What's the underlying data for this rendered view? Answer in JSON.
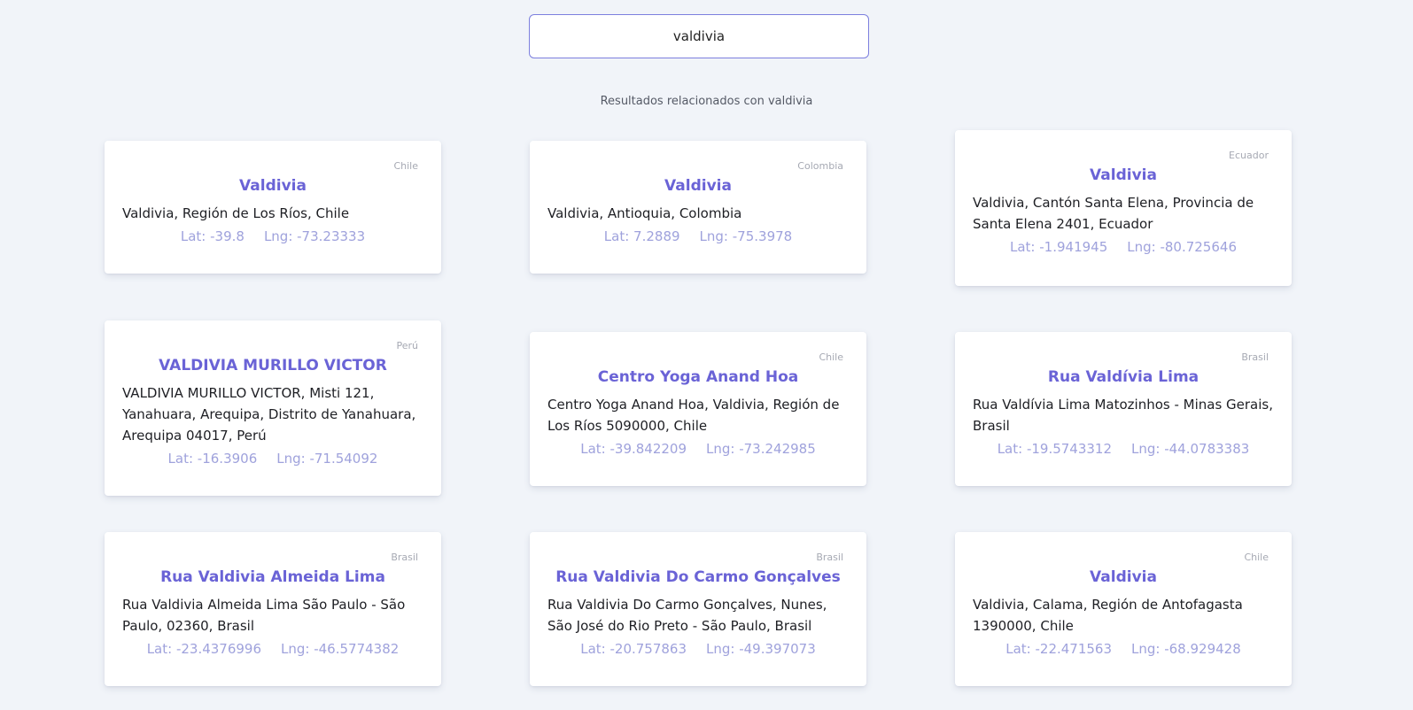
{
  "search": {
    "value": "valdivia"
  },
  "results_heading": "Resultados relacionados con valdivia",
  "results": [
    {
      "country": "Chile",
      "title": "Valdivia",
      "address": "Valdivia, Región de Los Ríos, Chile",
      "lat": "Lat: -39.8",
      "lng": "Lng: -73.23333"
    },
    {
      "country": "Colombia",
      "title": "Valdivia",
      "address": "Valdivia, Antioquia, Colombia",
      "lat": "Lat: 7.2889",
      "lng": "Lng: -75.3978"
    },
    {
      "country": "Ecuador",
      "title": "Valdivia",
      "address": "Valdivia, Cantón Santa Elena, Provincia de Santa Elena 2401, Ecuador",
      "lat": "Lat: -1.941945",
      "lng": "Lng: -80.725646"
    },
    {
      "country": "Perú",
      "title": "VALDIVIA MURILLO VICTOR",
      "address": "VALDIVIA MURILLO VICTOR, Misti 121, Yanahuara, Arequipa, Distrito de Yanahuara, Arequipa 04017, Perú",
      "lat": "Lat: -16.3906",
      "lng": "Lng: -71.54092"
    },
    {
      "country": "Chile",
      "title": "Centro Yoga Anand Hoa",
      "address": "Centro Yoga Anand Hoa, Valdivia, Región de Los Ríos 5090000, Chile",
      "lat": "Lat: -39.842209",
      "lng": "Lng: -73.242985"
    },
    {
      "country": "Brasil",
      "title": "Rua Valdívia Lima",
      "address": "Rua Valdívia Lima Matozinhos - Minas Gerais, Brasil",
      "lat": "Lat: -19.5743312",
      "lng": "Lng: -44.0783383"
    },
    {
      "country": "Brasil",
      "title": "Rua Valdivia Almeida Lima",
      "address": "Rua Valdivia Almeida Lima São Paulo - São Paulo, 02360, Brasil",
      "lat": "Lat: -23.4376996",
      "lng": "Lng: -46.5774382"
    },
    {
      "country": "Brasil",
      "title": "Rua Valdivia Do Carmo Gonçalves",
      "address": "Rua Valdivia Do Carmo Gonçalves, Nunes, São José do Rio Preto - São Paulo, Brasil",
      "lat": "Lat: -20.757863",
      "lng": "Lng: -49.397073"
    },
    {
      "country": "Chile",
      "title": "Valdivia",
      "address": "Valdivia, Calama, Región de Antofagasta 1390000, Chile",
      "lat": "Lat: -22.471563",
      "lng": "Lng: -68.929428"
    }
  ]
}
